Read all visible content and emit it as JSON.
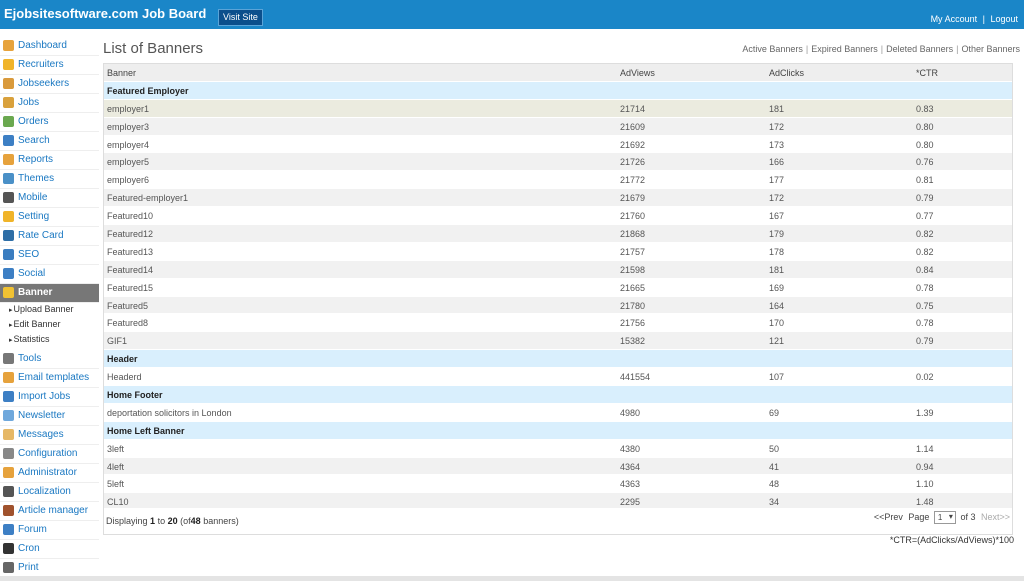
{
  "header": {
    "brand": "Ejobsitesoftware.com Job Board",
    "visit_site": "Visit Site",
    "my_account": "My Account",
    "separator": "|",
    "logout": "Logout"
  },
  "sidebar": {
    "items": [
      {
        "label": "Dashboard",
        "icon": "house-icon",
        "color": "#e7a33c"
      },
      {
        "label": "Recruiters",
        "icon": "recruiter-icon",
        "color": "#f0b429"
      },
      {
        "label": "Jobseekers",
        "icon": "jobseeker-icon",
        "color": "#d99a3c"
      },
      {
        "label": "Jobs",
        "icon": "jobs-icon",
        "color": "#d9a13c"
      },
      {
        "label": "Orders",
        "icon": "orders-icon",
        "color": "#6aa84f"
      },
      {
        "label": "Search",
        "icon": "search-icon",
        "color": "#3d7fc4"
      },
      {
        "label": "Reports",
        "icon": "book-icon",
        "color": "#e6a23c"
      },
      {
        "label": "Themes",
        "icon": "themes-icon",
        "color": "#4a90c7"
      },
      {
        "label": "Mobile",
        "icon": "mobile-icon",
        "color": "#555555"
      },
      {
        "label": "Setting",
        "icon": "gear-icon",
        "color": "#f0b429"
      },
      {
        "label": "Rate Card",
        "icon": "dollar-icon",
        "color": "#2e6ea6"
      },
      {
        "label": "SEO",
        "icon": "bar-chart-icon",
        "color": "#3a7dc0"
      },
      {
        "label": "Social",
        "icon": "globe-icon",
        "color": "#3d7fc4"
      },
      {
        "label": "Banner",
        "icon": "banner-icon",
        "color": "#f1c232",
        "active": true
      },
      {
        "label": "Tools",
        "icon": "tools-icon",
        "color": "#777777"
      },
      {
        "label": "Email templates",
        "icon": "email-icon",
        "color": "#e6a23c"
      },
      {
        "label": "Import Jobs",
        "icon": "import-icon",
        "color": "#3d7fc4"
      },
      {
        "label": "Newsletter",
        "icon": "newsletter-icon",
        "color": "#6fa8dc"
      },
      {
        "label": "Messages",
        "icon": "messages-icon",
        "color": "#e6b866"
      },
      {
        "label": "Configuration",
        "icon": "configuration-icon",
        "color": "#888888"
      },
      {
        "label": "Administrator",
        "icon": "administrator-icon",
        "color": "#e6a23c"
      },
      {
        "label": "Localization",
        "icon": "clock-icon",
        "color": "#555555"
      },
      {
        "label": "Article manager",
        "icon": "pencil-icon",
        "color": "#a0522d"
      },
      {
        "label": "Forum",
        "icon": "forum-icon",
        "color": "#3d7fc4"
      },
      {
        "label": "Cron",
        "icon": "cron-icon",
        "color": "#333333"
      },
      {
        "label": "Print",
        "icon": "print-icon",
        "color": "#666666"
      }
    ],
    "banner_sub": [
      "Upload Banner",
      "Edit Banner",
      "Statistics"
    ]
  },
  "main": {
    "title": "List of Banners",
    "filters": [
      "Active Banners",
      "Expired Banners",
      "Deleted Banners",
      "Other Banners"
    ],
    "filter_sep": "|",
    "columns": [
      "Banner",
      "AdViews",
      "AdClicks",
      "*CTR"
    ],
    "rows": [
      {
        "type": "group",
        "label": "Featured Employer"
      },
      {
        "type": "data",
        "cells": [
          "employer1",
          "21714",
          "181",
          "0.83"
        ],
        "highlight": true
      },
      {
        "type": "data",
        "cells": [
          "employer3",
          "21609",
          "172",
          "0.80"
        ]
      },
      {
        "type": "data",
        "cells": [
          "employer4",
          "21692",
          "173",
          "0.80"
        ]
      },
      {
        "type": "data",
        "cells": [
          "employer5",
          "21726",
          "166",
          "0.76"
        ]
      },
      {
        "type": "data",
        "cells": [
          "employer6",
          "21772",
          "177",
          "0.81"
        ]
      },
      {
        "type": "data",
        "cells": [
          "Featured-employer1",
          "21679",
          "172",
          "0.79"
        ]
      },
      {
        "type": "data",
        "cells": [
          "Featured10",
          "21760",
          "167",
          "0.77"
        ]
      },
      {
        "type": "data",
        "cells": [
          "Featured12",
          "21868",
          "179",
          "0.82"
        ]
      },
      {
        "type": "data",
        "cells": [
          "Featured13",
          "21757",
          "178",
          "0.82"
        ]
      },
      {
        "type": "data",
        "cells": [
          "Featured14",
          "21598",
          "181",
          "0.84"
        ]
      },
      {
        "type": "data",
        "cells": [
          "Featured15",
          "21665",
          "169",
          "0.78"
        ]
      },
      {
        "type": "data",
        "cells": [
          "Featured5",
          "21780",
          "164",
          "0.75"
        ]
      },
      {
        "type": "data",
        "cells": [
          "Featured8",
          "21756",
          "170",
          "0.78"
        ]
      },
      {
        "type": "data",
        "cells": [
          "GIF1",
          "15382",
          "121",
          "0.79"
        ]
      },
      {
        "type": "group",
        "label": "Header"
      },
      {
        "type": "data",
        "cells": [
          "Headerd",
          "441554",
          "107",
          "0.02"
        ]
      },
      {
        "type": "group",
        "label": "Home Footer"
      },
      {
        "type": "data",
        "cells": [
          "deportation solicitors in London",
          "4980",
          "69",
          "1.39"
        ]
      },
      {
        "type": "group",
        "label": "Home Left Banner"
      },
      {
        "type": "data",
        "cells": [
          "3left",
          "4380",
          "50",
          "1.14"
        ]
      },
      {
        "type": "data",
        "cells": [
          "4left",
          "4364",
          "41",
          "0.94"
        ]
      },
      {
        "type": "data",
        "cells": [
          "5left",
          "4363",
          "48",
          "1.10"
        ]
      },
      {
        "type": "data",
        "cells": [
          "CL10",
          "2295",
          "34",
          "1.48"
        ]
      }
    ],
    "footer": {
      "displaying": "Displaying",
      "from": "1",
      "to_word": "to",
      "to": "20",
      "of_open": "(of",
      "total": "48",
      "banners_close": "banners)",
      "prev": "<<Prev",
      "page_word": "Page",
      "page_value": "1",
      "of_pages": "of 3",
      "next": "Next>>"
    },
    "ctr_note": "*CTR=(AdClicks/AdViews)*100"
  },
  "colors": {
    "topbar": "#1a86c8",
    "link": "#1a78c2",
    "group_row": "#d9effd",
    "active_side": "#777777"
  }
}
